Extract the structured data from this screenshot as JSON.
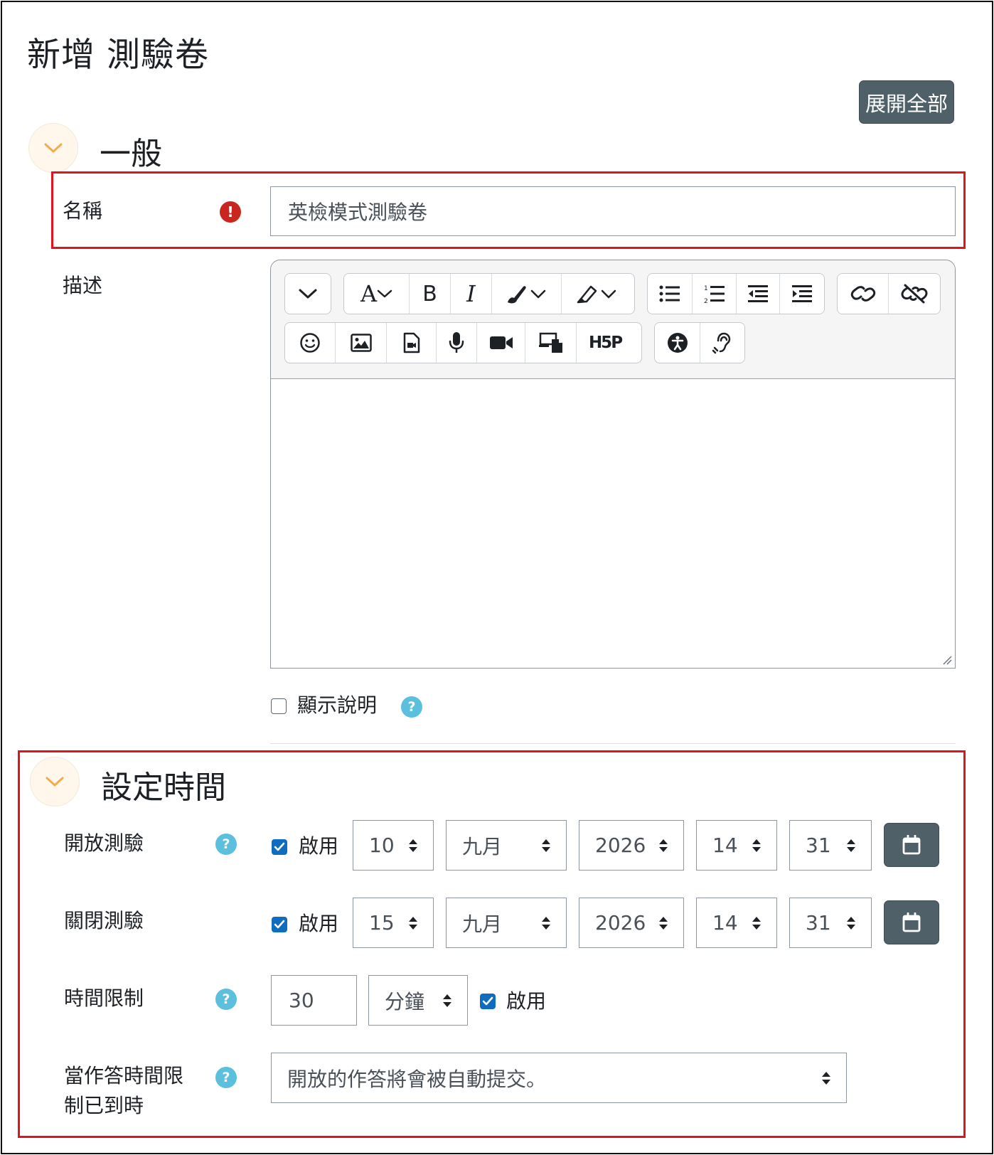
{
  "page": {
    "title": "新增 測驗卷",
    "expand_all_label": "展開全部"
  },
  "general": {
    "title": "一般",
    "name_label": "名稱",
    "name_value": "英檢模式測驗卷",
    "description_label": "描述",
    "show_description_label": "顯示說明",
    "show_description_checked": false
  },
  "editor_toolbar": {
    "row1": [
      [
        "chevron-down-icon"
      ],
      [
        "font-size-icon",
        "bold-icon",
        "italic-icon",
        "text-color-icon",
        "highlight-icon"
      ],
      [
        "unordered-list-icon",
        "ordered-list-icon",
        "outdent-icon",
        "indent-icon"
      ],
      [
        "link-icon",
        "unlink-icon"
      ]
    ],
    "row2": [
      [
        "emoji-icon",
        "image-icon",
        "media-file-icon",
        "microphone-icon",
        "video-camera-icon",
        "manage-files-icon",
        "h5p-icon"
      ],
      [
        "accessibility-checker-icon",
        "screen-reader-icon"
      ]
    ],
    "bold_glyph": "B",
    "italic_glyph": "I",
    "font_glyph": "A",
    "h5p_glyph": "H5P"
  },
  "timing": {
    "title": "設定時間",
    "open": {
      "label": "開放測驗",
      "enable_label": "啟用",
      "enabled": true,
      "day": "10",
      "month": "九月",
      "year": "2026",
      "hour": "14",
      "minute": "31"
    },
    "close": {
      "label": "關閉測驗",
      "enable_label": "啟用",
      "enabled": true,
      "day": "15",
      "month": "九月",
      "year": "2026",
      "hour": "14",
      "minute": "31"
    },
    "time_limit": {
      "label": "時間限制",
      "value": "30",
      "unit": "分鐘",
      "enable_label": "啟用",
      "enabled": true
    },
    "when_expires": {
      "label_line1": "當作答時間限",
      "label_line2": "制已到時",
      "value": "開放的作答將會被自動提交。"
    }
  },
  "colors": {
    "accent_button": "#4f6068",
    "highlight_border": "#e0141e",
    "error_icon": "#c8261e",
    "help_icon": "#5bc0de",
    "checkbox_checked": "#0f6cbf",
    "section_toggle": "#f0ad4e"
  }
}
